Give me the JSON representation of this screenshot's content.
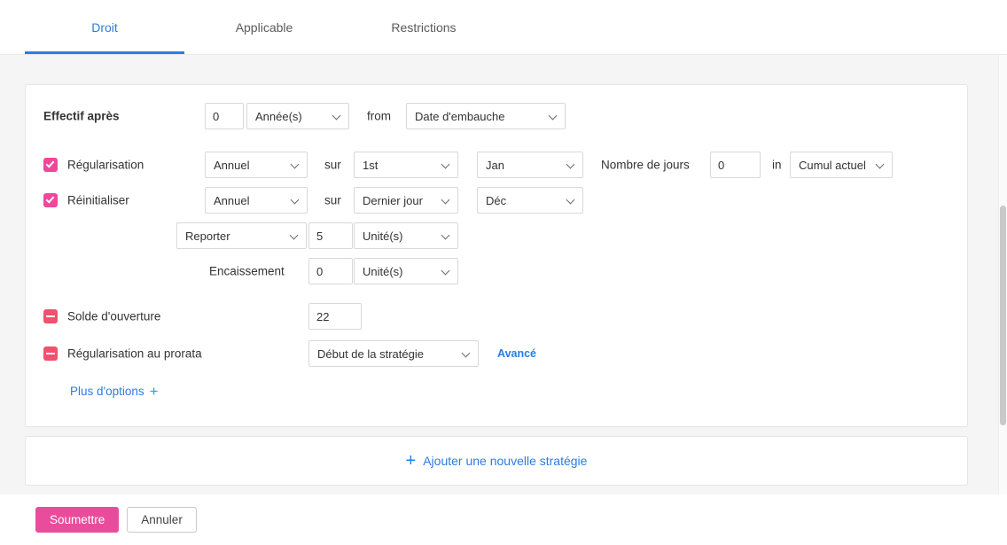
{
  "tabs": {
    "droit": "Droit",
    "applicable": "Applicable",
    "restrictions": "Restrictions"
  },
  "form": {
    "effective": {
      "label": "Effectif après",
      "value": "0",
      "unit": "Année(s)",
      "from_label": "from",
      "from_value": "Date d'embauche"
    },
    "accrual": {
      "label": "Régularisation",
      "frequency": "Annuel",
      "on_label": "sur",
      "day": "1st",
      "month": "Jan",
      "days_label": "Nombre de jours",
      "days_value": "0",
      "in_label": "in",
      "accumulation": "Cumul actuel"
    },
    "reset": {
      "label": "Réinitialiser",
      "frequency": "Annuel",
      "on_label": "sur",
      "day": "Dernier jour",
      "month": "Déc"
    },
    "carryover": {
      "type": "Reporter",
      "value": "5",
      "unit": "Unité(s)"
    },
    "encashment": {
      "label": "Encaissement",
      "value": "0",
      "unit": "Unité(s)"
    },
    "opening_balance": {
      "label": "Solde d'ouverture",
      "value": "22"
    },
    "prorate": {
      "label": "Régularisation au prorata",
      "value": "Début de la stratégie",
      "advanced": "Avancé"
    },
    "more_options": "Plus d'options",
    "more_options_plus": "+"
  },
  "add_policy": {
    "plus": "+",
    "label": "Ajouter une nouvelle stratégie"
  },
  "actions": {
    "submit": "Soumettre",
    "cancel": "Annuler"
  },
  "colors": {
    "accent_pink": "#ea4c9c",
    "checkbox_checked": "#f0479c",
    "checkbox_indeterminate": "#f2506e",
    "link_blue": "#2a7de1",
    "tab_active_blue": "#2a7de1",
    "content_background": "#f5f5f6"
  }
}
